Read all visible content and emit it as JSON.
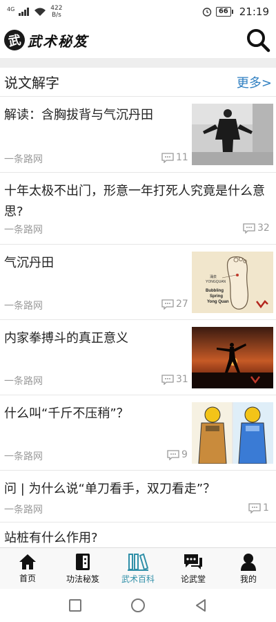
{
  "status_bar": {
    "network": "4G",
    "net_speed_value": "422",
    "net_speed_unit": "B/s",
    "battery": "66",
    "time": "21:19"
  },
  "app_bar": {
    "logo_glyph": "武",
    "logo_text": "武术秘笈"
  },
  "section": {
    "title": "说文解字",
    "more": "更多>"
  },
  "articles": [
    {
      "title": "解读：含胸拔背与气沉丹田",
      "source": "一条路网",
      "comments": "11",
      "has_thumb": true
    },
    {
      "title": "十年太极不出门，形意一年打死人究竟是什么意思?",
      "source": "一条路网",
      "comments": "32",
      "has_thumb": false
    },
    {
      "title": "气沉丹田",
      "source": "一条路网",
      "comments": "27",
      "has_thumb": true,
      "thumb_text": [
        "涌泉",
        "YONGQUAN",
        "Bubbling",
        "Spring",
        "Yong Quan"
      ]
    },
    {
      "title": "内家拳搏斗的真正意义",
      "source": "一条路网",
      "comments": "31",
      "has_thumb": true
    },
    {
      "title": "什么叫“千斤不压稍”？",
      "source": "一条路网",
      "comments": "9",
      "has_thumb": true
    },
    {
      "title": "问 | 为什么说“单刀看手，双刀看走”？",
      "source": "一条路网",
      "comments": "1",
      "has_thumb": false
    },
    {
      "title": "站桩有什么作用?",
      "has_thumb": false
    }
  ],
  "tab_bar": [
    {
      "label": "首页",
      "icon": "home-icon",
      "active": false
    },
    {
      "label": "功法秘笈",
      "icon": "book-icon",
      "active": false
    },
    {
      "label": "武术百科",
      "icon": "library-icon",
      "active": true
    },
    {
      "label": "论武堂",
      "icon": "chat-icon",
      "active": false
    },
    {
      "label": "我的",
      "icon": "user-icon",
      "active": false
    }
  ],
  "colors": {
    "accent": "#2f7fc1",
    "active_tab": "#2f8fa8",
    "meta_text": "#9a9a9a"
  }
}
